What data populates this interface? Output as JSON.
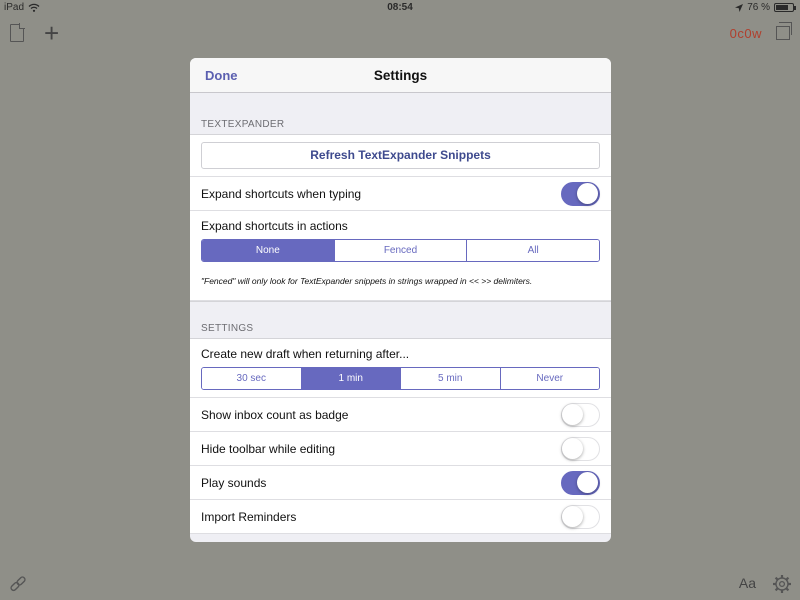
{
  "status_bar": {
    "device": "iPad",
    "time": "08:54",
    "battery_text": "76 %",
    "battery_level": 0.76
  },
  "app_toolbar": {
    "count_text": "0c0w"
  },
  "bottom_toolbar": {
    "font_label": "Aa"
  },
  "modal": {
    "title": "Settings",
    "done_label": "Done",
    "textexpander": {
      "header": "TEXTEXPANDER",
      "refresh_label": "Refresh TextExpander Snippets",
      "expand_typing_label": "Expand shortcuts when typing",
      "expand_typing_on": true,
      "expand_actions_label": "Expand shortcuts in actions",
      "expand_actions_options": [
        "None",
        "Fenced",
        "All"
      ],
      "expand_actions_selected": "None",
      "note": "\"Fenced\" will only look for TextExpander snippets in strings wrapped in << >> delimiters."
    },
    "settings": {
      "header": "SETTINGS",
      "new_draft_label": "Create new draft when returning after...",
      "new_draft_options": [
        "30 sec",
        "1 min",
        "5 min",
        "Never"
      ],
      "new_draft_selected": "1 min",
      "toggles": [
        {
          "label": "Show inbox count as badge",
          "on": false
        },
        {
          "label": "Hide toolbar while editing",
          "on": false
        },
        {
          "label": "Play sounds",
          "on": true
        },
        {
          "label": "Import Reminders",
          "on": false
        }
      ]
    }
  },
  "colors": {
    "accent": "#6769bf",
    "backdrop": "#8f8f88",
    "count_red": "#b0402e"
  }
}
